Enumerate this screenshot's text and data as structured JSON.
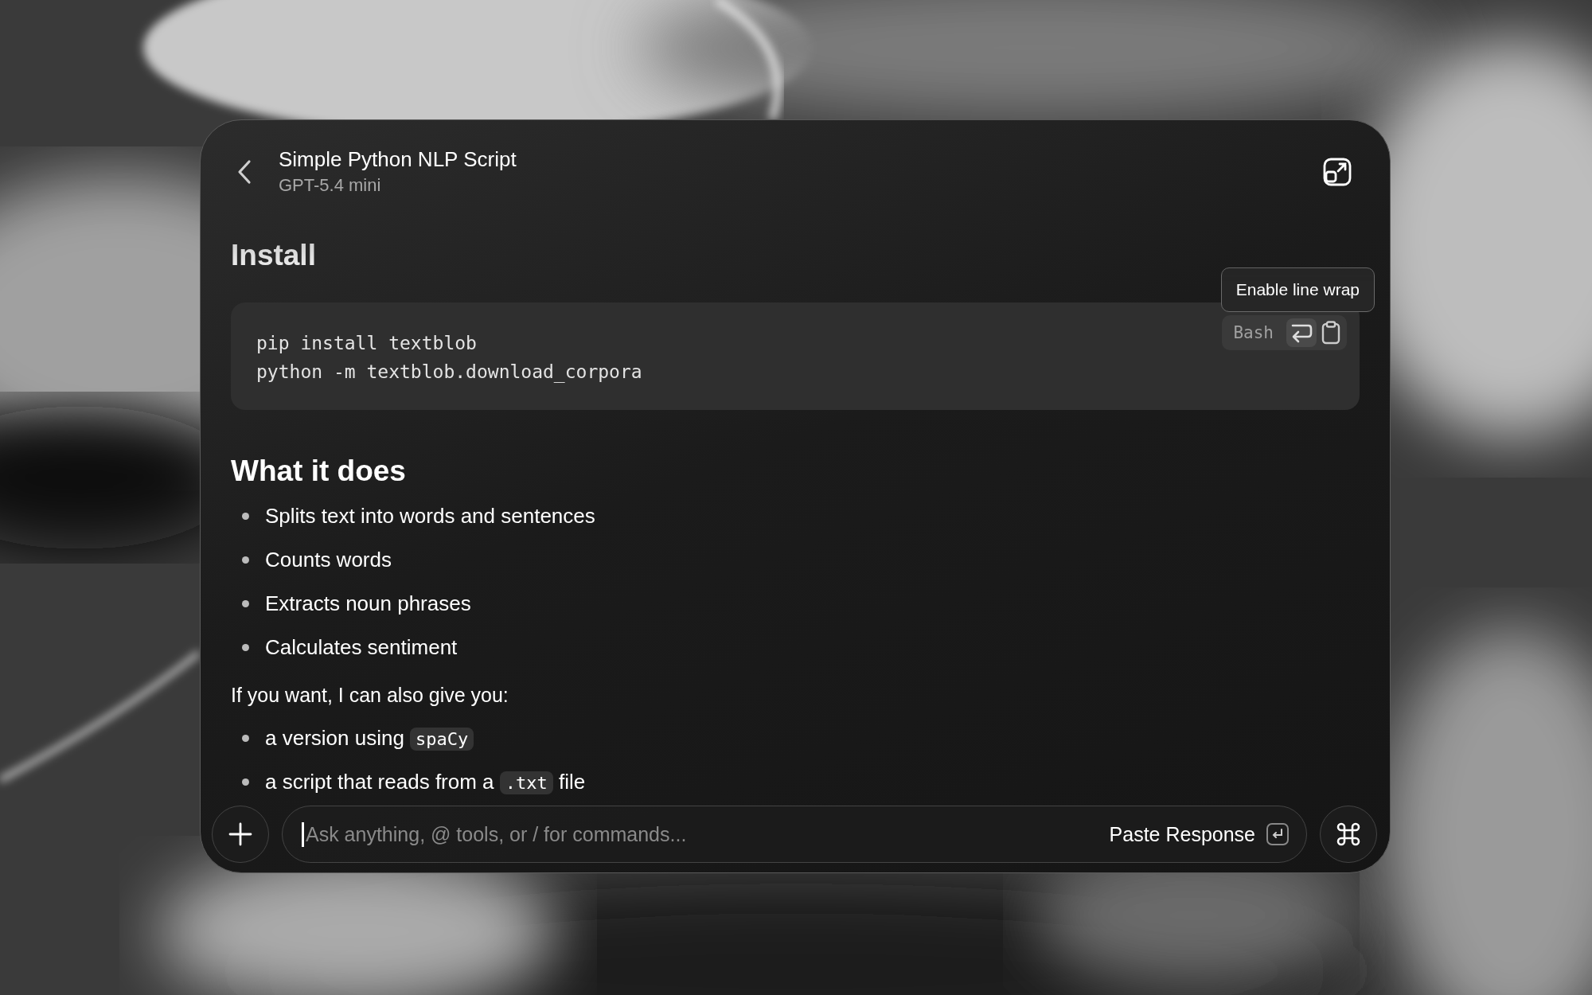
{
  "header": {
    "title": "Simple Python NLP Script",
    "subtitle": "GPT-5.4 mini"
  },
  "content": [
    {
      "kind": "heading",
      "text": "Install"
    },
    {
      "kind": "code",
      "language": "Bash",
      "tooltip": "Enable line wrap",
      "lines": [
        "pip install textblob",
        "python -m textblob.download_corpora"
      ]
    },
    {
      "kind": "heading",
      "text": "What it does"
    },
    {
      "kind": "bullets",
      "items": [
        {
          "parts": [
            {
              "kind": "text",
              "text": "Splits text into words and sentences"
            }
          ]
        },
        {
          "parts": [
            {
              "kind": "text",
              "text": "Counts words"
            }
          ]
        },
        {
          "parts": [
            {
              "kind": "text",
              "text": "Extracts noun phrases"
            }
          ]
        },
        {
          "parts": [
            {
              "kind": "text",
              "text": "Calculates sentiment"
            }
          ]
        }
      ]
    },
    {
      "kind": "paragraph",
      "text": "If you want, I can also give you:"
    },
    {
      "kind": "bullets",
      "items": [
        {
          "parts": [
            {
              "kind": "text",
              "text": "a version using "
            },
            {
              "kind": "code",
              "text": "spaCy"
            }
          ]
        },
        {
          "parts": [
            {
              "kind": "text",
              "text": "a script that reads from a "
            },
            {
              "kind": "code",
              "text": ".txt"
            },
            {
              "kind": "text",
              "text": " file"
            }
          ]
        }
      ]
    }
  ],
  "composer": {
    "placeholder": "Ask anything, @ tools, or / for commands...",
    "action": "Paste Response"
  }
}
